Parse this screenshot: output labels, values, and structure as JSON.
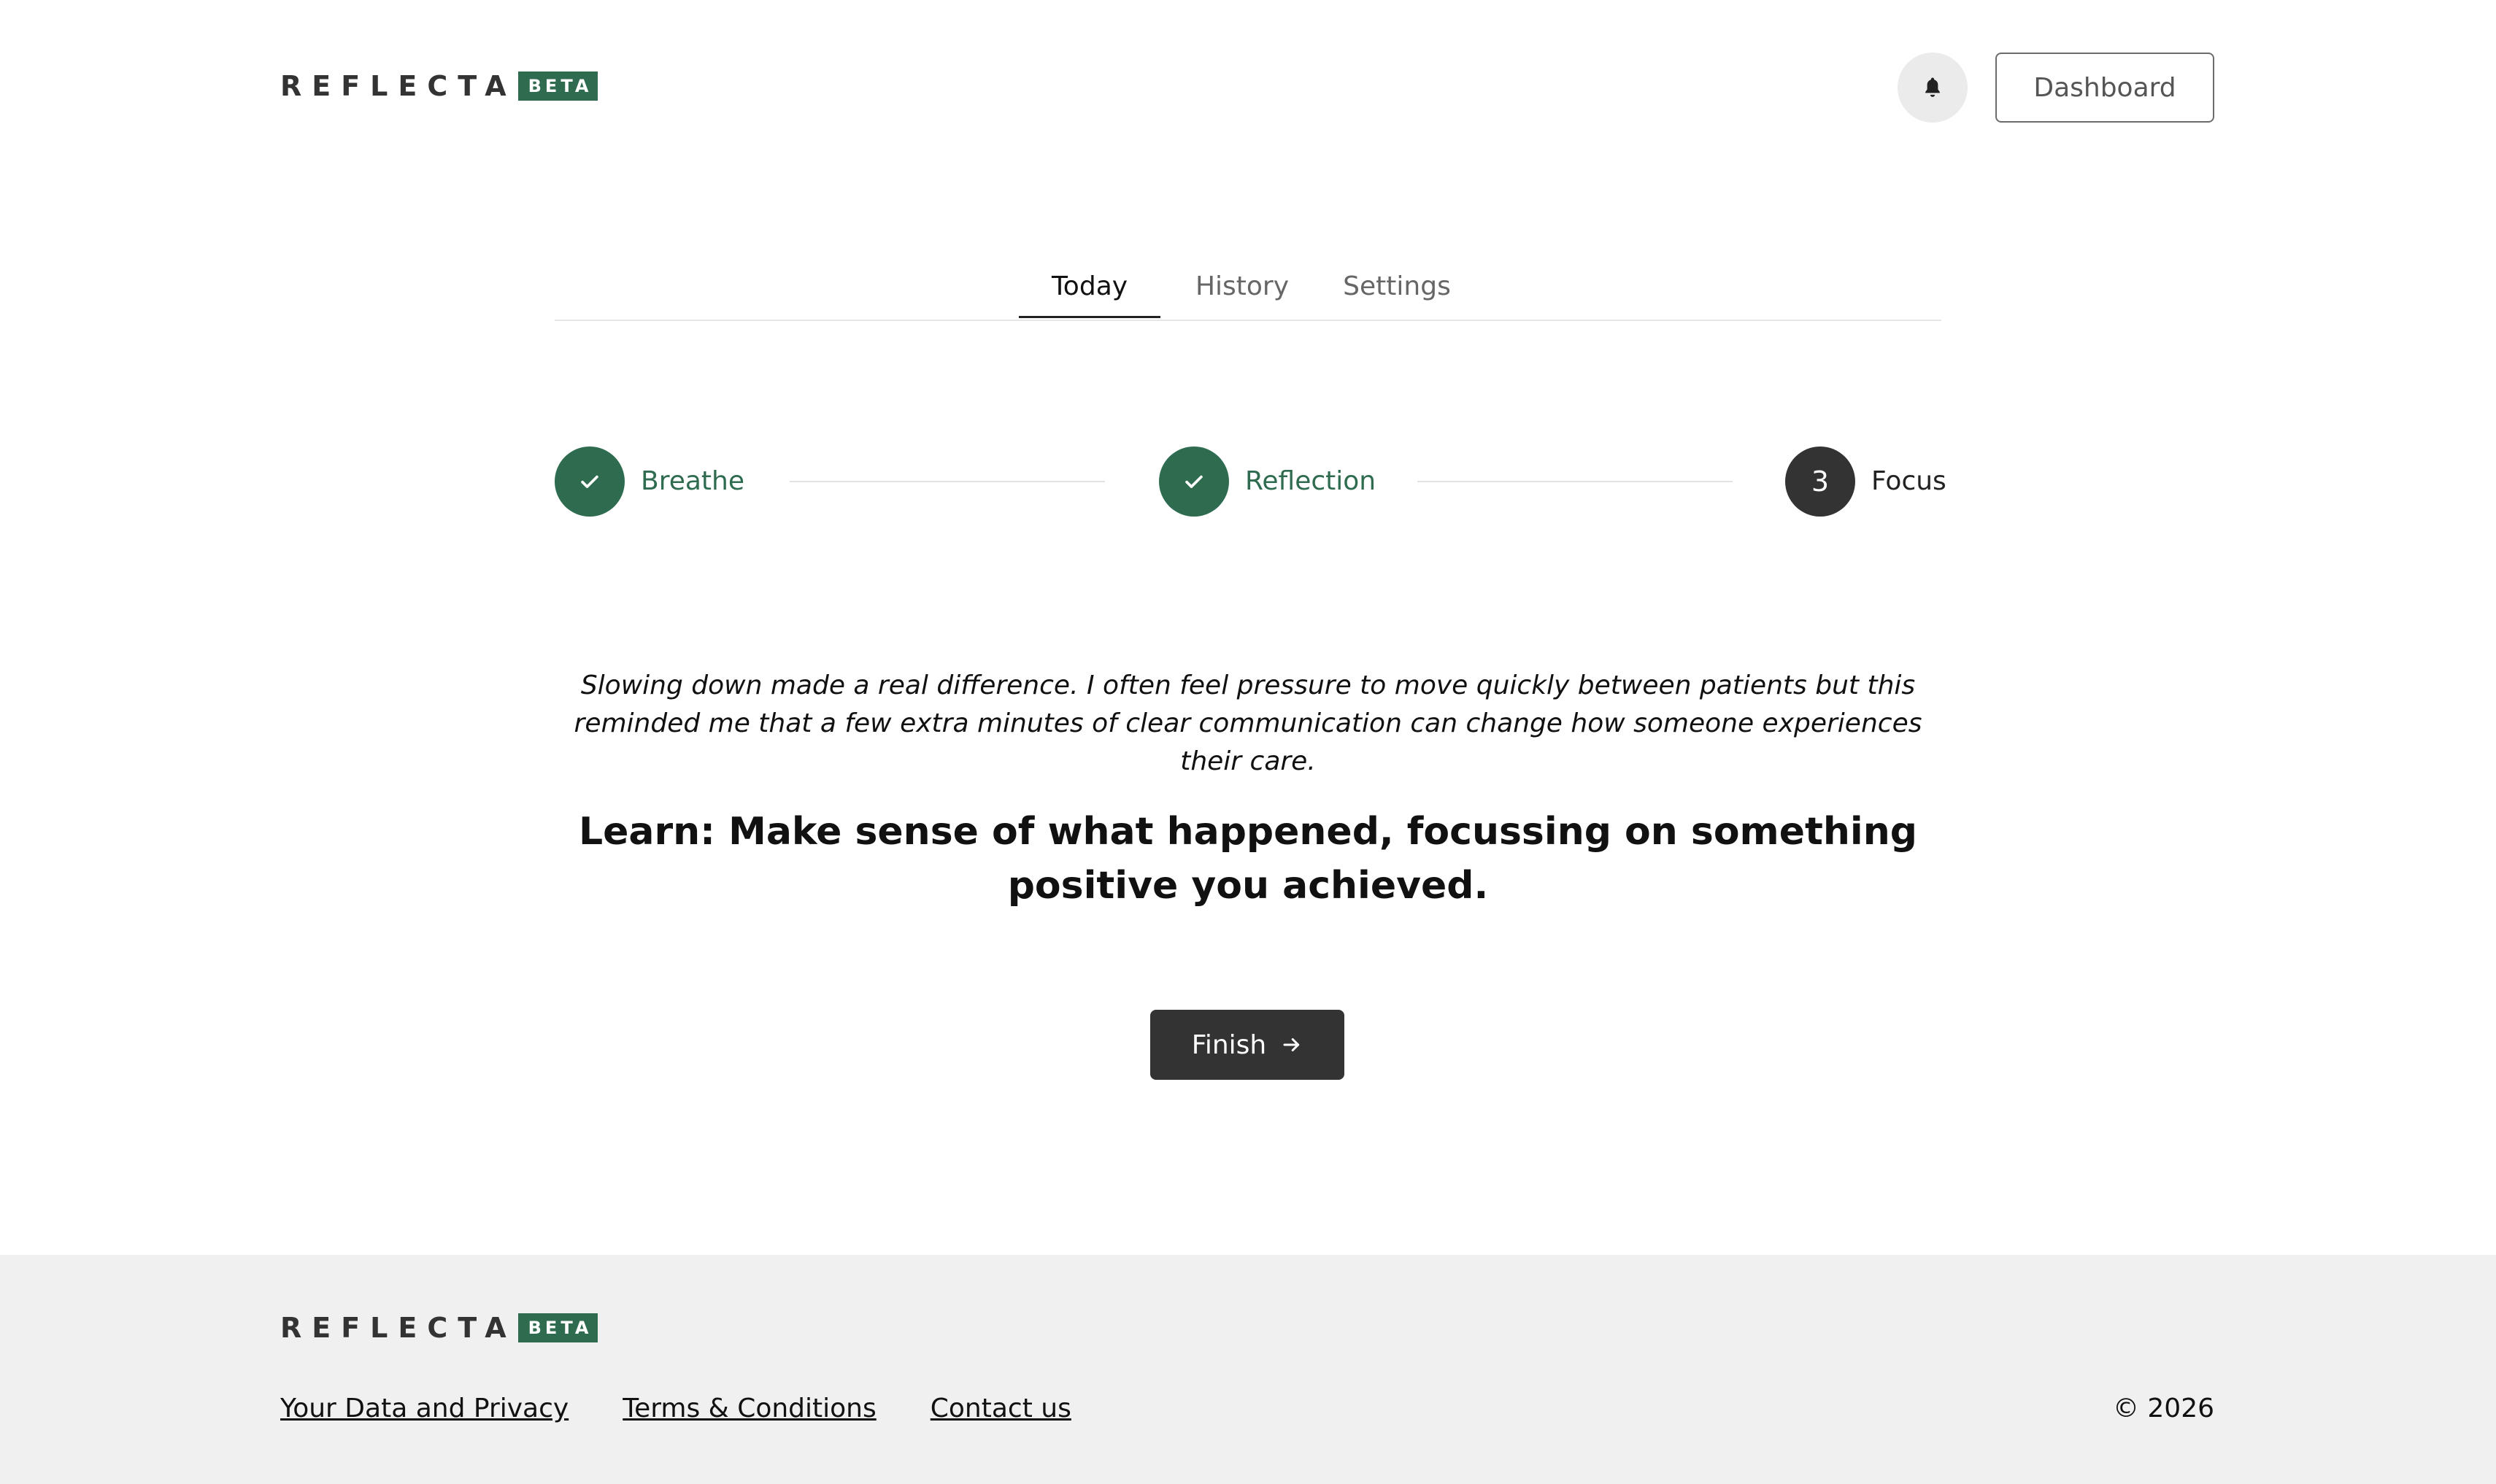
{
  "brand": {
    "name": "REFLECTA",
    "badge": "BETA",
    "accent_color": "#2e6b4f"
  },
  "header": {
    "notification_icon": "bell-icon",
    "dashboard_label": "Dashboard"
  },
  "tabs": [
    {
      "label": "Today",
      "active": true
    },
    {
      "label": "History",
      "active": false
    },
    {
      "label": "Settings",
      "active": false
    }
  ],
  "steps": [
    {
      "label": "Breathe",
      "status": "done",
      "icon": "check-icon"
    },
    {
      "label": "Reflection",
      "status": "done",
      "icon": "check-icon"
    },
    {
      "number": "3",
      "label": "Focus",
      "status": "current"
    }
  ],
  "reflection_text": "Slowing down made a real difference. I often feel pressure to move quickly between patients but this reminded me that a few extra minutes of clear communication can change how someone experiences their care.",
  "prompt": "Learn: Make sense of what happened, focussing on something positive you achieved.",
  "finish_button": {
    "label": "Finish",
    "icon": "arrow-right-icon"
  },
  "footer": {
    "links": [
      "Your Data and Privacy",
      "Terms & Conditions",
      "Contact us"
    ],
    "copyright": "© 2026"
  }
}
